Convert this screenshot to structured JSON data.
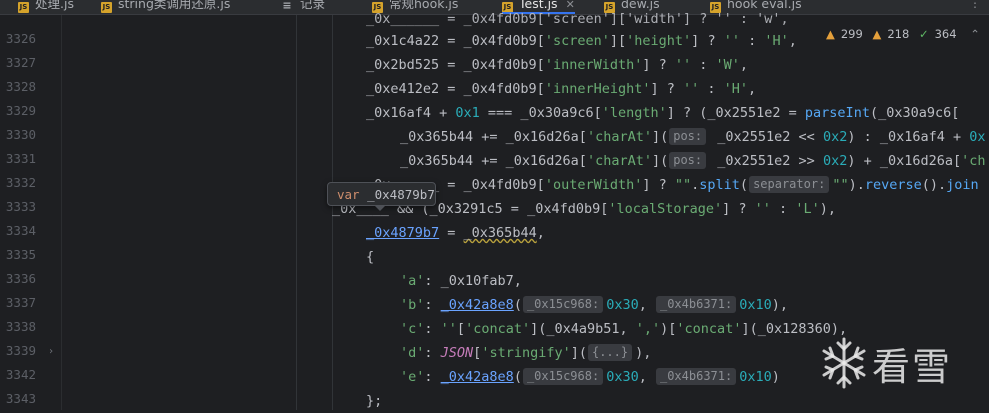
{
  "tabs": [
    {
      "label": "处理.js",
      "active": false
    },
    {
      "label": "string类调用还原.js",
      "active": false
    },
    {
      "label": "记录",
      "active": false
    },
    {
      "label": "常规hook.js",
      "active": false
    },
    {
      "label": "Test.js",
      "active": true
    },
    {
      "label": "dew.js",
      "active": false
    },
    {
      "label": "hook eval.js",
      "active": false
    }
  ],
  "inspections": {
    "errors": "299",
    "warnings": "218",
    "weak": "364"
  },
  "gutter": {
    "line_numbers": [
      "3326",
      "3327",
      "3328",
      "3329",
      "3330",
      "3331",
      "3332",
      "3333",
      "3334",
      "3335",
      "3336",
      "3337",
      "3338",
      "3339",
      "3342",
      "3343"
    ]
  },
  "code": {
    "top_partial": "_0x______ = _0x4fd0b9['screen']['width'] ? '' : 'w',",
    "l3326": {
      "a": "_0x1c4a22",
      "b": " = ",
      "c": "_0x4fd0b9",
      "d": "['screen']",
      "e": "['height']",
      "f": " ? ",
      "g": "''",
      "h": " : ",
      "i": "'H'",
      "j": ","
    },
    "l3327": {
      "a": "_0x2bd525 = _0x4fd0b9[",
      "b": "'innerWidth'",
      "c": "] ? ",
      "d": "''",
      "e": " : ",
      "f": "'W'",
      "g": ","
    },
    "l3328": {
      "a": "_0xe412e2 = _0x4fd0b9[",
      "b": "'innerHeight'",
      "c": "] ? ",
      "d": "''",
      "e": " : ",
      "f": "'H'",
      "g": ","
    },
    "l3329": {
      "a": "_0x16af4 + ",
      "b": "0x1",
      "c": " === _0x30a9c6[",
      "d": "'length'",
      "e": "] ? (_0x2551e2 = ",
      "f": "parseInt",
      "g": "(_0x30a9c6["
    },
    "l3330": {
      "a": "_0x365b44 += _0x16d26a[",
      "b": "'charAt'",
      "c": "](",
      "hint": "pos:",
      "d": " _0x2551e2 << ",
      "e": "0x2",
      "f": ") : _0x16af4 + ",
      "g": "0x"
    },
    "l3331": {
      "a": "_0x365b44 += _0x16d26a[",
      "b": "'charAt'",
      "c": "](",
      "hint": "pos:",
      "d": " _0x2551e2 >> ",
      "e": "0x2",
      "f": ") + _0x16d26a[",
      "g": "'ch"
    },
    "l3332": {
      "a": "_0x______ = _0x4fd0b9[",
      "b": "'outerWidth'",
      "c": "] ? ",
      "d": "\"\"",
      "e": ".",
      "f": "split",
      "g": "(",
      "hint": "separator:",
      "h": " ",
      "i": "\"\"",
      "j": ").",
      "k": "reverse",
      "l": "().",
      "m": "join"
    },
    "l3333": {
      "a": "_0x____ && (_0x3291c5 = _0x4fd0b9[",
      "b": "'localStorage'",
      "c": "] ? ",
      "d": "''",
      "e": " : ",
      "f": "'L'",
      "g": "),"
    },
    "l3334": {
      "a": "_0x4879b7",
      "b": " = ",
      "c": "_0x365b44",
      "d": ","
    },
    "l3335": "{",
    "l3336": {
      "a": "'a'",
      "b": ": _0x10fab7,"
    },
    "l3337": {
      "a": "'b'",
      "b": ": ",
      "c": "_0x42a8e8",
      "d": "(",
      "h1": "_0x15c968:",
      "e": "0x30",
      "f": ", ",
      "h2": "_0x4b6371:",
      "g": "0x10",
      "i": "),"
    },
    "l3338": {
      "a": "'c'",
      "b": ": ",
      "c": "''",
      "d": "[",
      "e": "'concat'",
      "f": "](_0x4a9b51, ",
      "g": "','",
      "h": ")[",
      "i": "'concat'",
      "j": "](_0x128360),"
    },
    "l3339": {
      "a": "'d'",
      "b": ": ",
      "c": "JSON",
      "d": "[",
      "e": "'stringify'",
      "f": "](",
      "hint": "{...}",
      "g": "),"
    },
    "l3342": {
      "a": "'e'",
      "b": ": ",
      "c": "_0x42a8e8",
      "d": "(",
      "h1": "_0x15c968:",
      "e": "0x30",
      "f": ", ",
      "h2": "_0x4b6371:",
      "g": "0x10",
      "i": ")"
    },
    "l3343": "};"
  },
  "popup": {
    "keyword": "var",
    "identifier": "_0x4879b7"
  },
  "watermark": {
    "text": "看雪",
    "icon": "snowflake-icon"
  },
  "colors": {
    "background": "#1e1f22",
    "string": "#6aab73",
    "number": "#2aacb8",
    "function": "#56a8f5",
    "keyword": "#cf8e6d",
    "accent": "#3574f0"
  }
}
